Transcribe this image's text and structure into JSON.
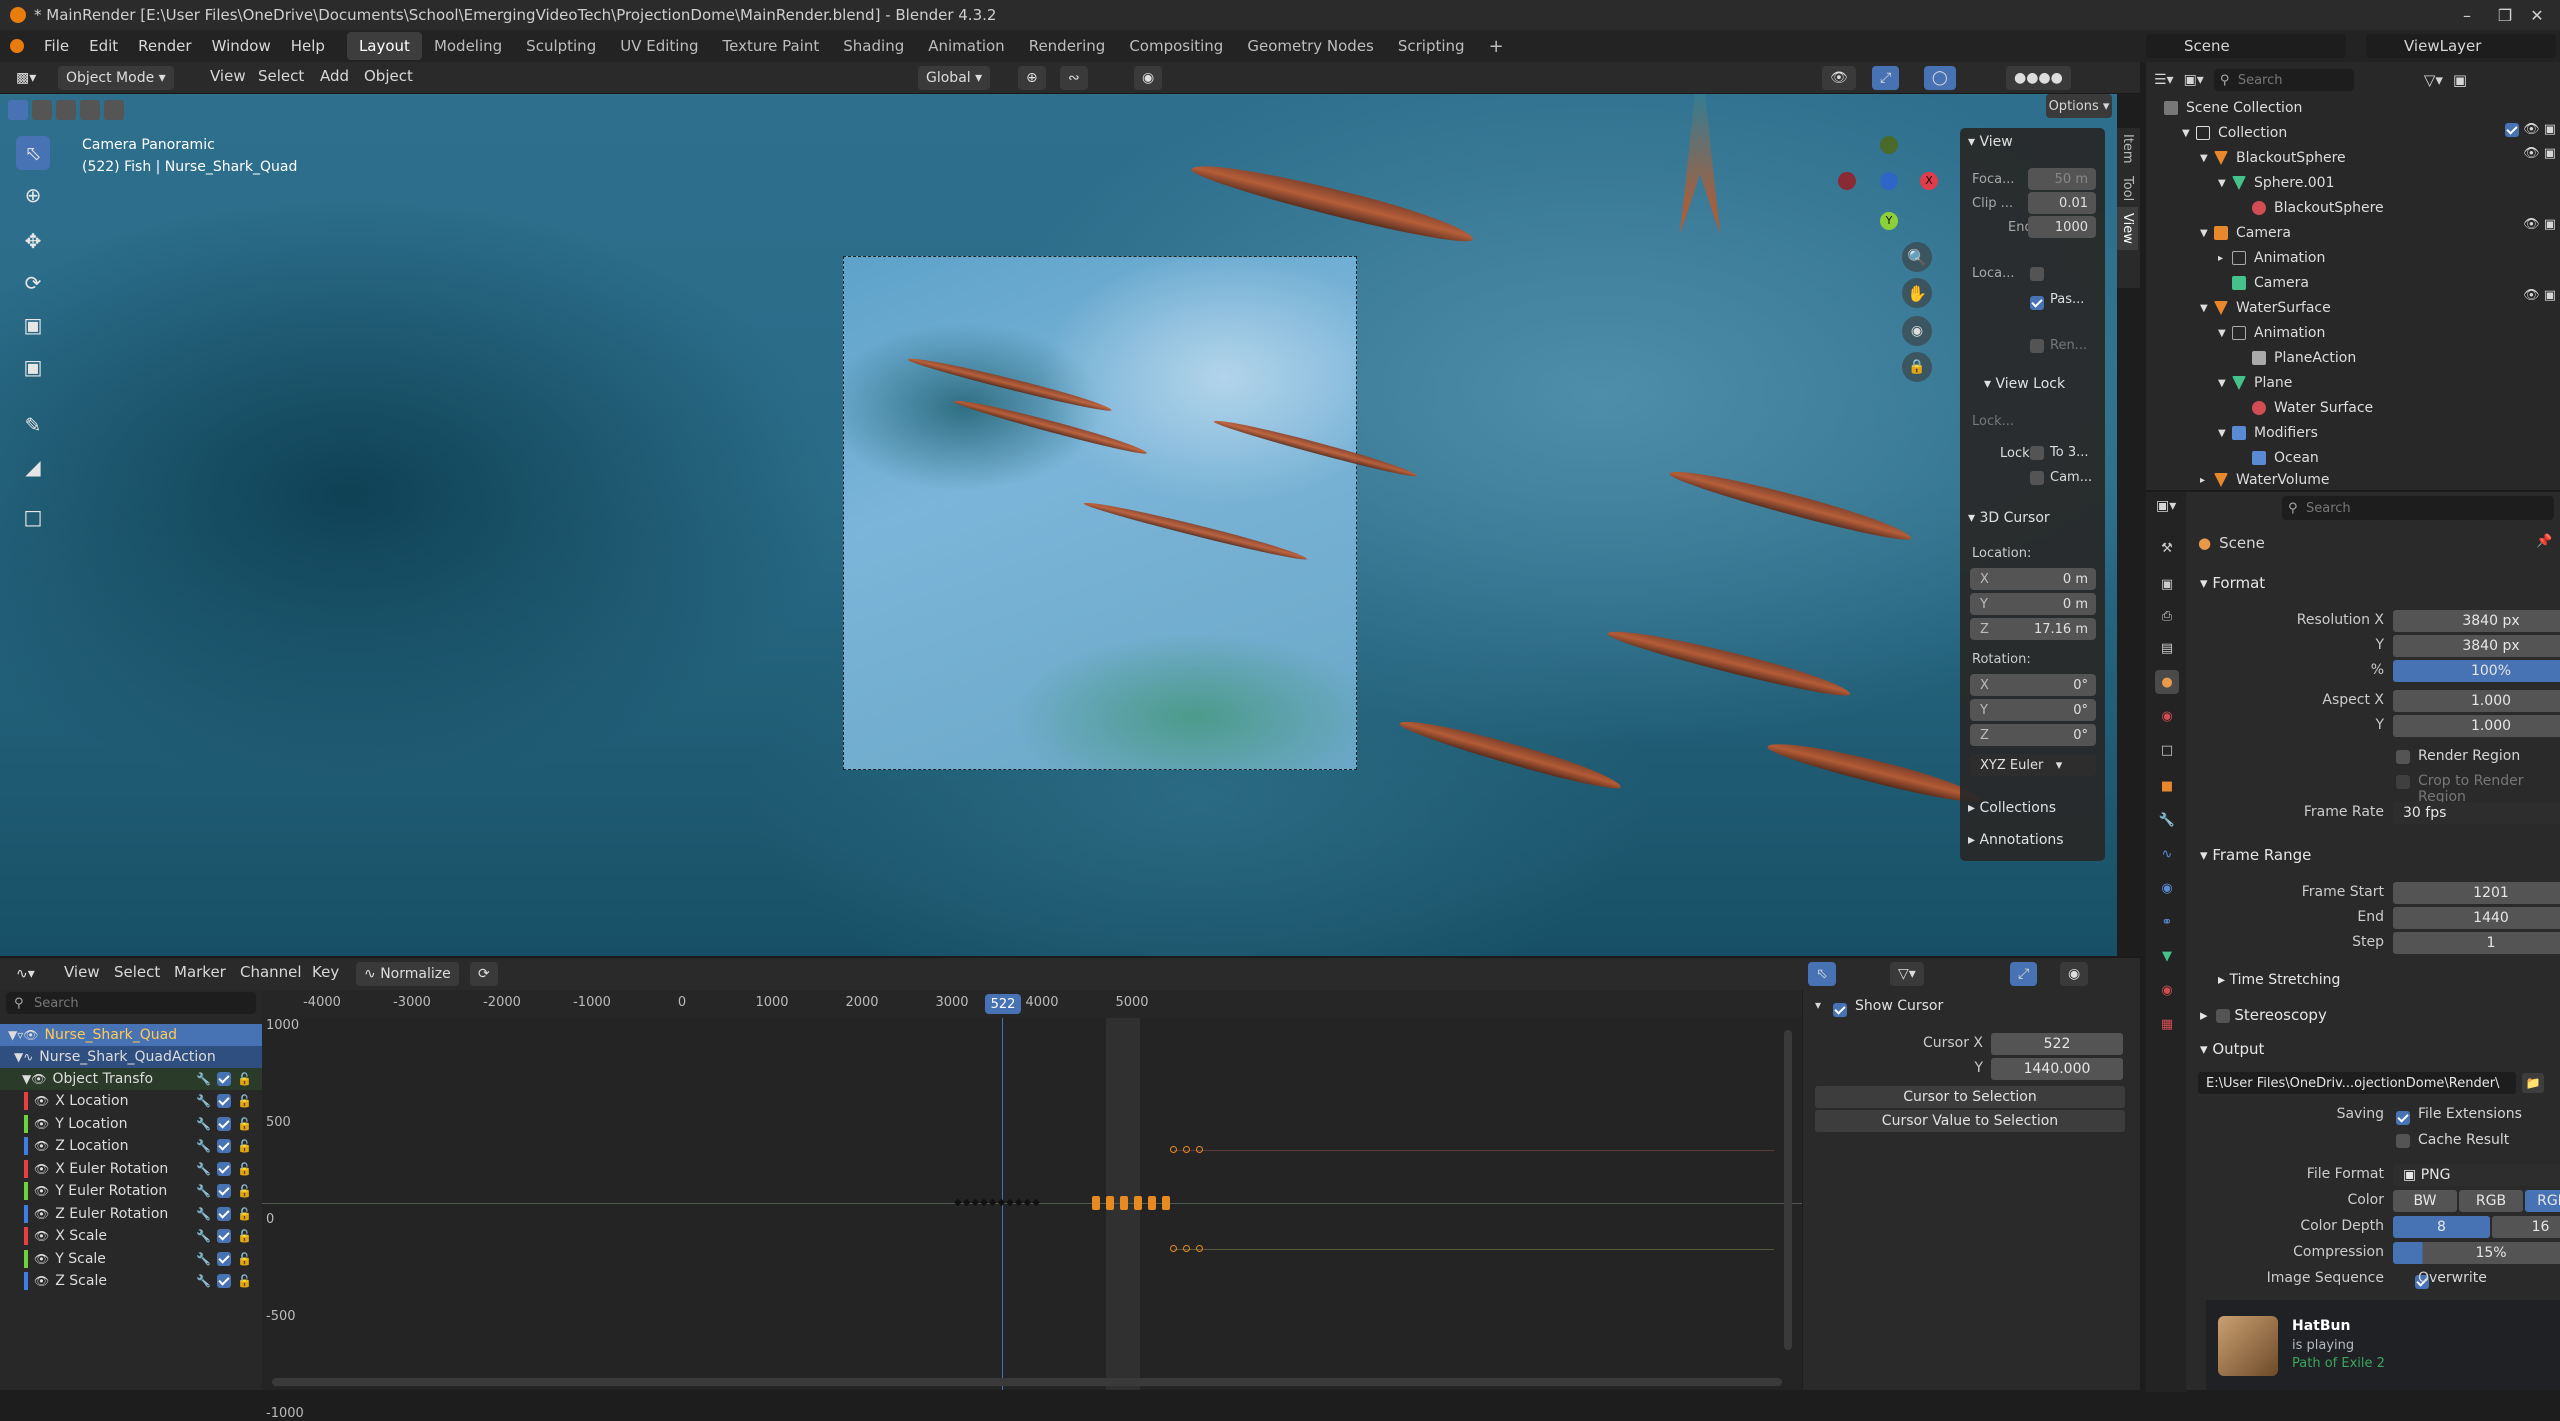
{
  "window": {
    "title": "* MainRender [E:\\User Files\\OneDrive\\Documents\\School\\EmergingVideoTech\\ProjectionDome\\MainRender.blend] - Blender 4.3.2",
    "minimize": "–",
    "maximize": "❒",
    "close": "✕"
  },
  "menu": {
    "file": "File",
    "edit": "Edit",
    "render": "Render",
    "window": "Window",
    "help": "Help"
  },
  "workspaces": [
    "Layout",
    "Modeling",
    "Sculpting",
    "UV Editing",
    "Texture Paint",
    "Shading",
    "Animation",
    "Rendering",
    "Compositing",
    "Geometry Nodes",
    "Scripting"
  ],
  "scene": {
    "label": "Scene",
    "view_layer": "ViewLayer"
  },
  "viewport_header": {
    "mode": "Object Mode",
    "view": "View",
    "select": "Select",
    "add": "Add",
    "object": "Object",
    "orientation": "Global",
    "options": "Options"
  },
  "viewport_overlay": {
    "line1": "Camera Panoramic",
    "line2": "(522) Fish | Nurse_Shark_Quad"
  },
  "gizmo": {
    "x": "X",
    "y": "Y",
    "z": "Z"
  },
  "npanel": {
    "view_title": "View",
    "focal_label": "Foca...",
    "focal_value": "50 m",
    "clip_label": "Clip ...",
    "clip_value": "0.01",
    "end_label": "End",
    "end_value": "1000",
    "local_label": "Loca...",
    "pass_label": "Pas...",
    "ren_label": "Ren...",
    "viewlock_title": "View Lock",
    "lock_obj_label": "Lock...",
    "lock_label": "Lock",
    "to3d_label": "To 3...",
    "cam_label": "Cam...",
    "cursor_title": "3D Cursor",
    "location_label": "Location:",
    "loc_x": "0 m",
    "loc_y": "0 m",
    "loc_z": "17.16 m",
    "rotation_label": "Rotation:",
    "rot_x": "0°",
    "rot_y": "0°",
    "rot_z": "0°",
    "rot_mode": "XYZ Euler",
    "collections": "Collections",
    "annotations": "Annotations",
    "tabs": [
      "Item",
      "Tool",
      "View"
    ]
  },
  "graph_header": {
    "view": "View",
    "select": "Select",
    "marker": "Marker",
    "channel": "Channel",
    "key": "Key",
    "normalize": "Normalize"
  },
  "graph": {
    "search_placeholder": "Search",
    "current_frame": "522",
    "x_ticks": [
      "-4000",
      "-3000",
      "-2000",
      "-1000",
      "0",
      "1000",
      "2000",
      "3000",
      "4000",
      "5000"
    ],
    "y_ticks": [
      "1000",
      "500",
      "0",
      "-500",
      "-1000"
    ]
  },
  "channels": [
    {
      "name": "Nurse_Shark_Quad",
      "color": ""
    },
    {
      "name": "Nurse_Shark_QuadAction",
      "color": ""
    },
    {
      "name": "Object Transfo",
      "color": ""
    },
    {
      "name": "X Location",
      "color": "#e83f3f"
    },
    {
      "name": "Y Location",
      "color": "#6fd23a"
    },
    {
      "name": "Z Location",
      "color": "#3f7ee8"
    },
    {
      "name": "X Euler Rotation",
      "color": "#e83f3f"
    },
    {
      "name": "Y Euler Rotation",
      "color": "#6fd23a"
    },
    {
      "name": "Z Euler Rotation",
      "color": "#3f7ee8"
    },
    {
      "name": "X Scale",
      "color": "#e83f3f"
    },
    {
      "name": "Y Scale",
      "color": "#6fd23a"
    },
    {
      "name": "Z Scale",
      "color": "#3f7ee8"
    }
  ],
  "graph_panel": {
    "show_cursor": "Show Cursor",
    "cursor_x_label": "Cursor X",
    "cursor_x": "522",
    "y_label": "Y",
    "y": "1440.000",
    "to_sel": "Cursor to Selection",
    "val_to_sel": "Cursor Value to Selection"
  },
  "outliner": {
    "search_placeholder": "Search",
    "items": [
      "Scene Collection",
      "Collection",
      "BlackoutSphere",
      "Sphere.001",
      "BlackoutSphere",
      "Camera",
      "Animation",
      "Camera",
      "WaterSurface",
      "Animation",
      "PlaneAction",
      "Plane",
      "Water Surface",
      "Modifiers",
      "Ocean",
      "WaterVolume"
    ]
  },
  "properties": {
    "search_placeholder": "Search",
    "scene": "Scene",
    "format_title": "Format",
    "res_x_label": "Resolution X",
    "res_x": "3840 px",
    "res_y_label": "Y",
    "res_y": "3840 px",
    "pct_label": "%",
    "pct": "100%",
    "aspect_x_label": "Aspect X",
    "aspect_x": "1.000",
    "aspect_y_label": "Y",
    "aspect_y": "1.000",
    "render_region": "Render Region",
    "crop_region": "Crop to Render Region",
    "frame_rate_label": "Frame Rate",
    "frame_rate": "30 fps",
    "frame_range_title": "Frame Range",
    "frame_start_label": "Frame Start",
    "frame_start": "1201",
    "end_label": "End",
    "end": "1440",
    "step_label": "Step",
    "step": "1",
    "time_stretching": "Time Stretching",
    "stereoscopy": "Stereoscopy",
    "output_title": "Output",
    "output_path": "E:\\User Files\\OneDriv...ojectionDome\\Render\\",
    "saving_label": "Saving",
    "file_ext": "File Extensions",
    "cache_result": "Cache Result",
    "file_format_label": "File Format",
    "file_format": "PNG",
    "color_label": "Color",
    "bw": "BW",
    "rgb": "RGB",
    "rgba": "RGBA",
    "depth_label": "Color Depth",
    "d8": "8",
    "d16": "16",
    "compression_label": "Compression",
    "compression": "15%",
    "image_seq_label": "Image Sequence",
    "overwrite": "Overwrite"
  },
  "discord": {
    "user": "HatBun",
    "status": "is playing",
    "game": "Path of Exile 2"
  }
}
